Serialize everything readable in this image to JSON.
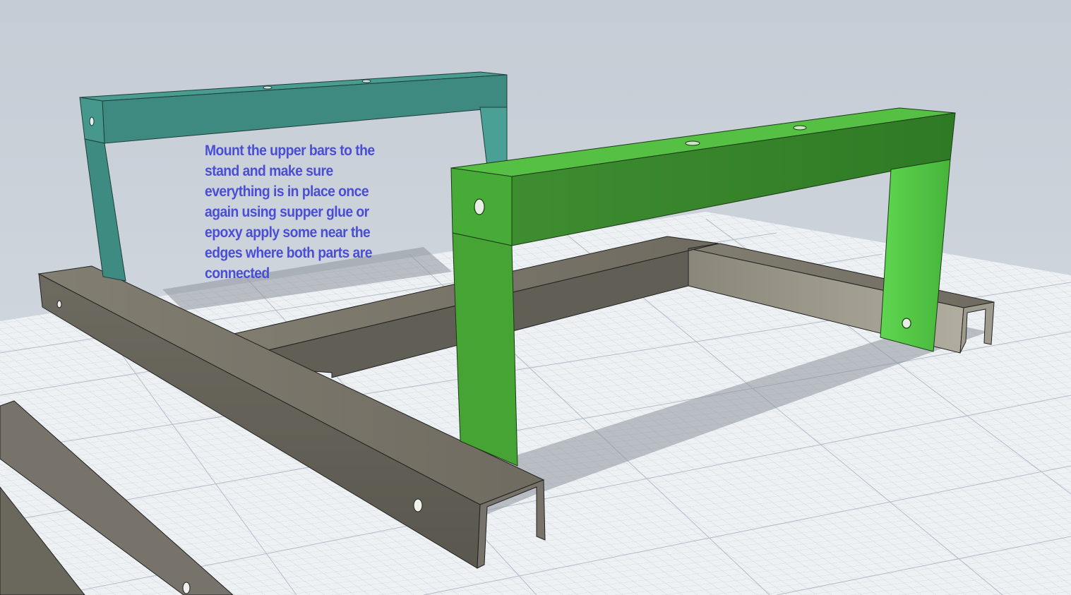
{
  "viewport": {
    "name": "3d-cad-viewport",
    "background_color": "#c9d0d8"
  },
  "annotation": {
    "text": "Mount the upper bars to the\nstand and make sure\neverything is in place once\nagain using supper glue or\nepoxy apply some near the\nedges where both parts are\nconnected",
    "color": "#4a4ed6"
  },
  "model": {
    "parts": [
      {
        "name": "upper-bar-back",
        "color": "#3f8a80"
      },
      {
        "name": "upper-bar-front",
        "color": "#4caf3c"
      },
      {
        "name": "stand-frame",
        "color": "#6e6a5e"
      }
    ]
  }
}
